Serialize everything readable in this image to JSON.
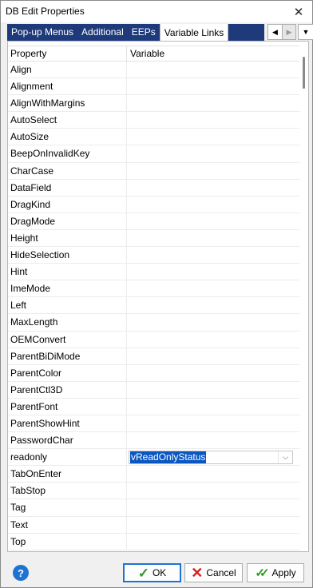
{
  "window": {
    "title": "DB Edit Properties",
    "close_glyph": "✕"
  },
  "tabs": [
    {
      "label": "Pop-up Menus",
      "active": false
    },
    {
      "label": "Additional",
      "active": false
    },
    {
      "label": "EEPs",
      "active": false
    },
    {
      "label": "Variable Links",
      "active": true
    }
  ],
  "tab_scroll": {
    "left_glyph": "◀",
    "right_glyph": "▶",
    "dropdown_glyph": "▼"
  },
  "grid": {
    "columns": [
      "Property",
      "Variable"
    ],
    "rows": [
      {
        "property": "Align",
        "variable": ""
      },
      {
        "property": "Alignment",
        "variable": ""
      },
      {
        "property": "AlignWithMargins",
        "variable": ""
      },
      {
        "property": "AutoSelect",
        "variable": ""
      },
      {
        "property": "AutoSize",
        "variable": ""
      },
      {
        "property": "BeepOnInvalidKey",
        "variable": ""
      },
      {
        "property": "CharCase",
        "variable": ""
      },
      {
        "property": "DataField",
        "variable": ""
      },
      {
        "property": "DragKind",
        "variable": ""
      },
      {
        "property": "DragMode",
        "variable": ""
      },
      {
        "property": "Height",
        "variable": ""
      },
      {
        "property": "HideSelection",
        "variable": ""
      },
      {
        "property": "Hint",
        "variable": ""
      },
      {
        "property": "ImeMode",
        "variable": ""
      },
      {
        "property": "Left",
        "variable": ""
      },
      {
        "property": "MaxLength",
        "variable": ""
      },
      {
        "property": "OEMConvert",
        "variable": ""
      },
      {
        "property": "ParentBiDiMode",
        "variable": ""
      },
      {
        "property": "ParentColor",
        "variable": ""
      },
      {
        "property": "ParentCtl3D",
        "variable": ""
      },
      {
        "property": "ParentFont",
        "variable": ""
      },
      {
        "property": "ParentShowHint",
        "variable": ""
      },
      {
        "property": "PasswordChar",
        "variable": ""
      },
      {
        "property": "readonly",
        "variable": "vReadOnlyStatus",
        "editing": true
      },
      {
        "property": "TabOnEnter",
        "variable": ""
      },
      {
        "property": "TabStop",
        "variable": ""
      },
      {
        "property": "Tag",
        "variable": ""
      },
      {
        "property": "Text",
        "variable": ""
      },
      {
        "property": "Top",
        "variable": ""
      },
      {
        "property": "",
        "variable": ""
      }
    ]
  },
  "buttons": {
    "help": "?",
    "ok": "OK",
    "cancel": "Cancel",
    "apply": "Apply"
  },
  "icons": {
    "ok": "check-icon",
    "cancel": "x-icon",
    "apply": "double-check-icon",
    "help": "help-icon"
  },
  "colors": {
    "accent": "#1e73d2",
    "tab_strip": "#1e3a7b",
    "selection": "#0a57c2"
  }
}
